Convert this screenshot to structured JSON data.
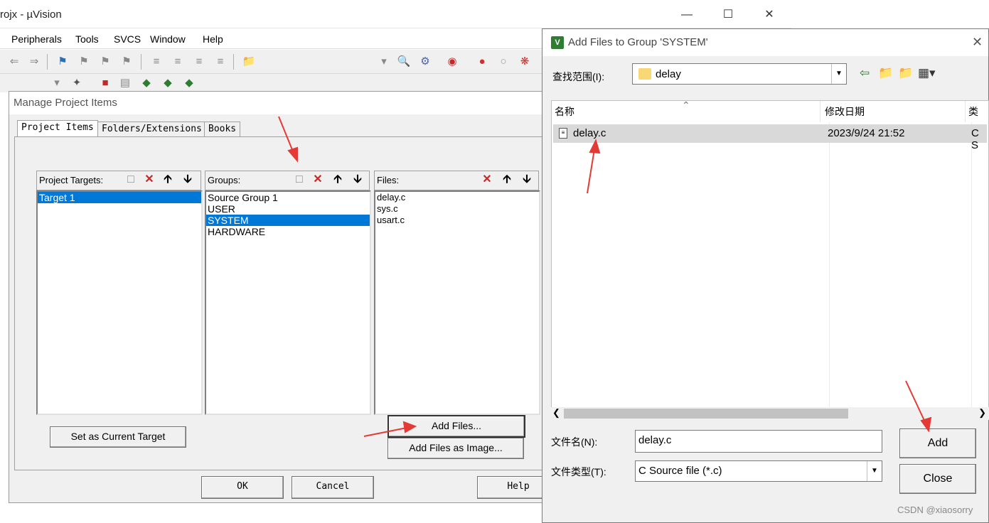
{
  "uvision": {
    "title": "rojx - µVision",
    "caption_min": "—",
    "caption_max": "☐",
    "caption_close": "✕",
    "menu": [
      "Peripherals",
      "Tools",
      "SVCS",
      "Window",
      "Help"
    ]
  },
  "manage_dialog": {
    "title": "Manage Project Items",
    "tabs": [
      "Project Items",
      "Folders/Extensions",
      "Books"
    ],
    "project_targets": {
      "label": "Project Targets:",
      "items": [
        "Target 1"
      ],
      "selected": 0
    },
    "groups": {
      "label": "Groups:",
      "items": [
        "Source Group 1",
        "USER",
        "SYSTEM",
        "HARDWARE"
      ],
      "selected": 2
    },
    "files": {
      "label": "Files:",
      "items": [
        "delay.c",
        "sys.c",
        "usart.c"
      ]
    },
    "set_current_target": "Set as Current Target",
    "add_files": "Add Files...",
    "add_files_image": "Add Files as Image...",
    "ok": "OK",
    "cancel": "Cancel",
    "help": "Help"
  },
  "add_dialog": {
    "title": "Add Files to Group 'SYSTEM'",
    "logo": "V",
    "look_in_label": "查找范围(I):",
    "look_in_value": "delay",
    "columns": [
      "名称",
      "修改日期",
      "类"
    ],
    "files": [
      {
        "name": "delay.c",
        "date": "2023/9/24 21:52",
        "type": "C S"
      }
    ],
    "filename_label": "文件名(N):",
    "filename_value": "delay.c",
    "filetype_label": "文件类型(T):",
    "filetype_value": "C Source file (*.c)",
    "add_button": "Add",
    "close_button": "Close"
  },
  "watermark": "CSDN @xiaosorry",
  "colors": {
    "selection": "#0078d7",
    "arrow": "#e53935",
    "add_row": "#d9d9d9"
  }
}
